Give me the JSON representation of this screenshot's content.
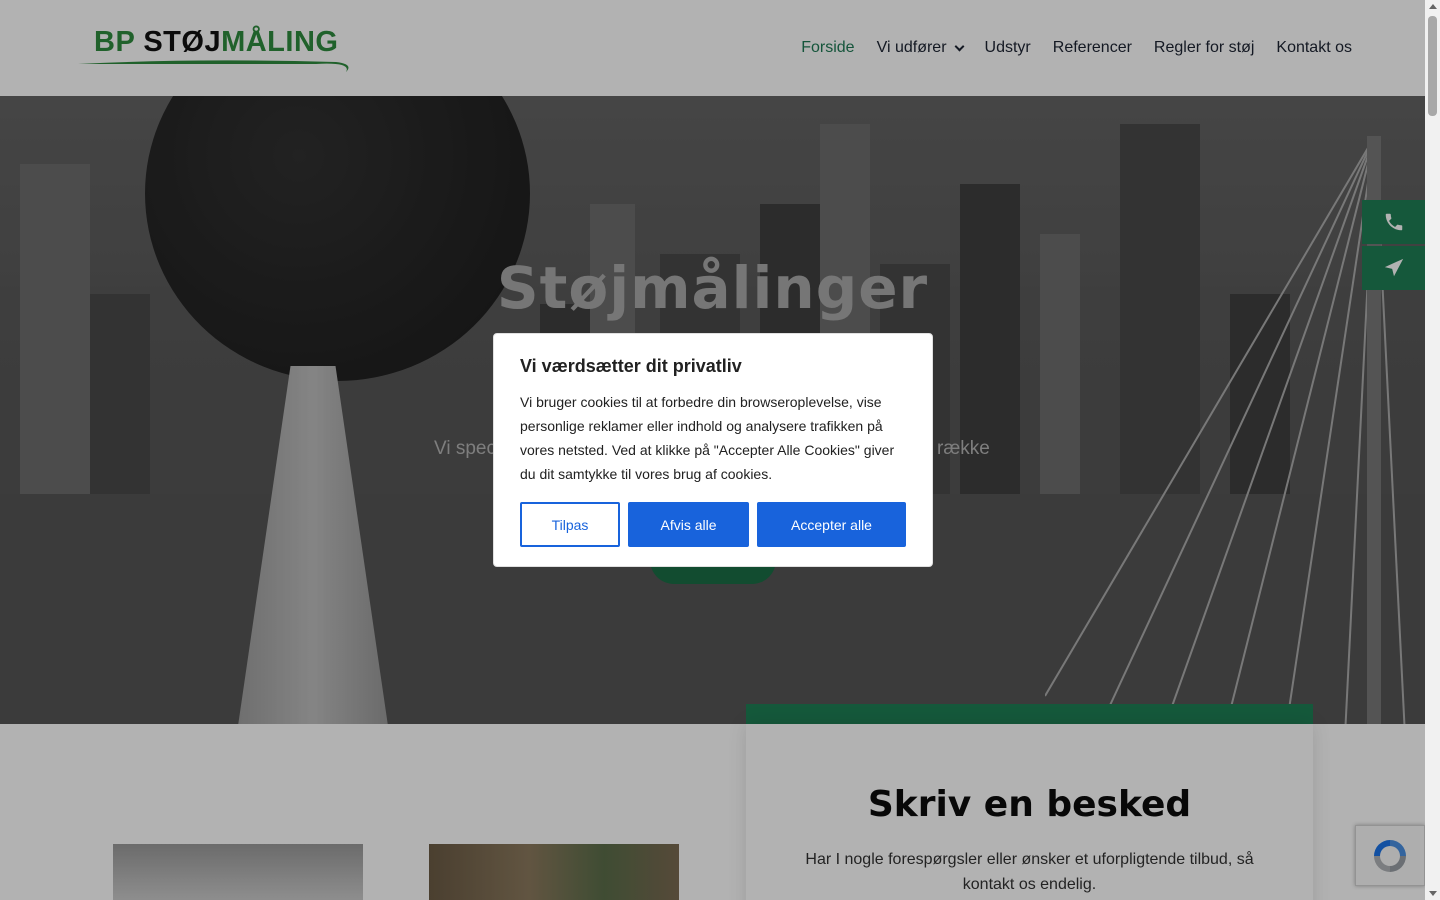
{
  "header": {
    "logo": {
      "part1": "BP ",
      "part2": "STØJ",
      "part3": "MÅLING"
    },
    "nav": [
      {
        "label": "Forside",
        "active": true
      },
      {
        "label": "Vi udfører",
        "dropdown": true
      },
      {
        "label": "Udstyr"
      },
      {
        "label": "Referencer"
      },
      {
        "label": "Regler for støj"
      },
      {
        "label": "Kontakt os"
      }
    ]
  },
  "hero": {
    "title": "Støjmålinger",
    "subtitle_left": "Vi spec",
    "subtitle_right": "række"
  },
  "float_buttons": {
    "phone_icon": "phone-icon",
    "send_icon": "paper-plane-icon"
  },
  "contact": {
    "title": "Skriv en besked",
    "text": "Har I nogle forespørgsler eller ønsker et uforpligtende tilbud, så kontakt os endelig."
  },
  "cookie_modal": {
    "title": "Vi værdsætter dit privatliv",
    "text": "Vi bruger cookies til at forbedre din browseroplevelse, vise personlige reklamer eller indhold og analysere trafikken på vores netsted. Ved at klikke på \"Accepter Alle Cookies\" giver du dit samtykke til vores brug af cookies.",
    "customize_label": "Tilpas",
    "reject_label": "Afvis alle",
    "accept_label": "Accepter alle"
  },
  "colors": {
    "brand_green": "#1f7f55",
    "nav_active": "#1f7a55",
    "cookie_blue": "#1863dc"
  }
}
